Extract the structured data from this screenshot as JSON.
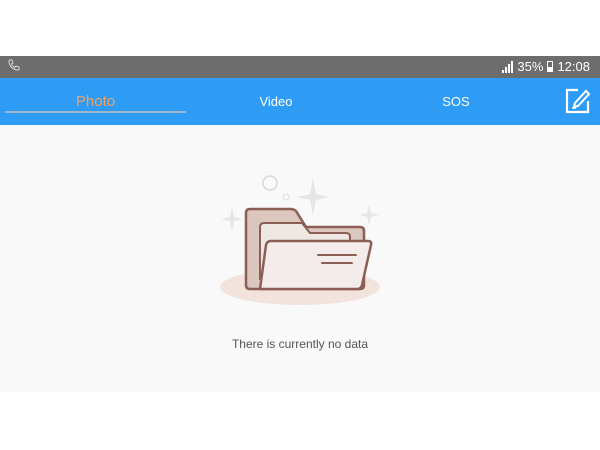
{
  "status_bar": {
    "battery": "35%",
    "time": "12:08",
    "left_icon": "phone-icon"
  },
  "tabs": [
    {
      "label": "Photo",
      "active": true
    },
    {
      "label": "Video",
      "active": false
    },
    {
      "label": "SOS",
      "active": false
    }
  ],
  "toolbar": {
    "edit_icon": "edit-icon"
  },
  "empty_state": {
    "message": "There is currently no data",
    "icon": "empty-folder-icon"
  },
  "colors": {
    "tab_bar": "#2e9cf4",
    "active_tab_text": "#f0a064",
    "status_bar": "#6d6d6d",
    "content_bg": "#f9f9f9"
  }
}
